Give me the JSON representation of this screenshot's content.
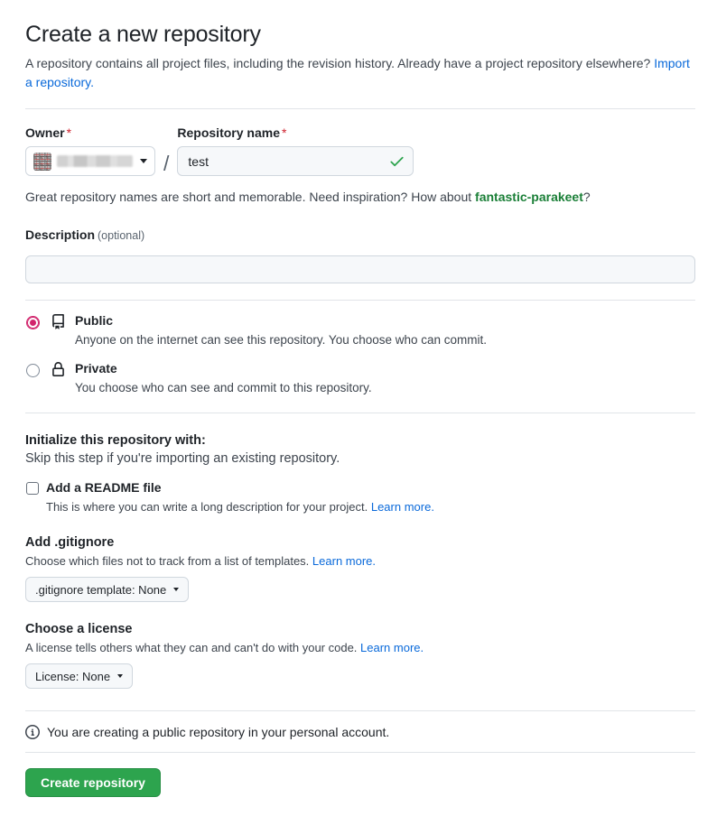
{
  "page": {
    "title": "Create a new repository",
    "intro_before_link": "A repository contains all project files, including the revision history. Already have a project repository elsewhere? ",
    "intro_link": "Import a repository.",
    "intro_after_link": ""
  },
  "owner": {
    "label": "Owner",
    "required_mark": "*",
    "value_redacted": true,
    "caret_icon": "chevron-down-icon"
  },
  "repo_name": {
    "label": "Repository name",
    "required_mark": "*",
    "value": "test",
    "placeholder": "",
    "valid_icon": "check-icon",
    "separator": "/"
  },
  "name_hint": {
    "before": "Great repository names are short and memorable. Need inspiration? How about ",
    "suggestion": "fantastic-parakeet",
    "after": "?"
  },
  "description": {
    "label": "Description",
    "optional": "(optional)",
    "value": "",
    "placeholder": ""
  },
  "visibility": {
    "selected": "public",
    "options": [
      {
        "id": "public",
        "title": "Public",
        "description": "Anyone on the internet can see this repository. You choose who can commit.",
        "icon": "repo-book-icon",
        "checked": true
      },
      {
        "id": "private",
        "title": "Private",
        "description": "You choose who can see and commit to this repository.",
        "icon": "lock-icon",
        "checked": false
      }
    ]
  },
  "initialize": {
    "heading": "Initialize this repository with:",
    "subheading": "Skip this step if you're importing an existing repository.",
    "readme": {
      "label": "Add a README file",
      "checked": false,
      "description_before_link": "This is where you can write a long description for your project. ",
      "learn_more": "Learn more."
    }
  },
  "gitignore": {
    "heading": "Add .gitignore",
    "description_before_link": "Choose which files not to track from a list of templates. ",
    "learn_more": "Learn more.",
    "button_label": ".gitignore template: None"
  },
  "license": {
    "heading": "Choose a license",
    "description_before_link": "A license tells others what they can and can't do with your code. ",
    "learn_more": "Learn more.",
    "button_label": "License: None"
  },
  "note": {
    "icon": "info-icon",
    "text": "You are creating a public repository in your personal account."
  },
  "submit": {
    "label": "Create repository"
  },
  "colors": {
    "accent_link": "#0969da",
    "suggestion_green": "#1a7f37",
    "radio_pink": "#d1246c",
    "button_green": "#2da44e",
    "required_red": "#cf222e",
    "check_green": "#2da44e"
  }
}
